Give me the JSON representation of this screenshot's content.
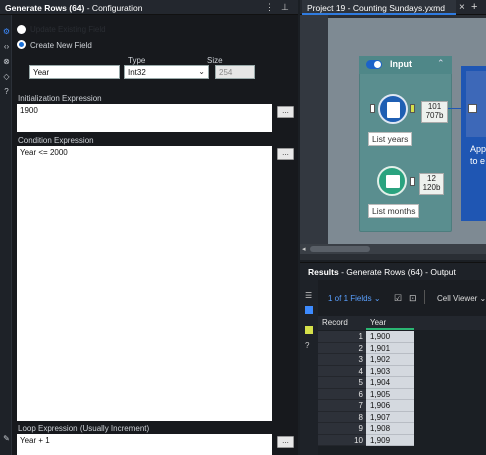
{
  "config": {
    "title_prefix": "Generate Rows (64)",
    "title_suffix": " - Configuration",
    "update_existing_label": "Update Existing Field",
    "create_new_label": "Create New  Field",
    "name_value": "Year",
    "type_label": "Type",
    "type_value": "Int32",
    "size_label": "Size",
    "size_value": "254",
    "init_label": "Initialization Expression",
    "init_value": "1900",
    "cond_label": "Condition Expression",
    "cond_value": "Year <= 2000",
    "loop_label": "Loop Expression (Usually Increment)",
    "loop_value": "Year + 1",
    "dots": "..."
  },
  "tab": {
    "title": "Project 19 - Counting Sundays.yxmd"
  },
  "canvas": {
    "container_title": "Input",
    "tool1_label": "List years",
    "tool1_count": "101",
    "tool1_size": "707b",
    "tool2_label": "List months",
    "tool2_count": "12",
    "tool2_size": "120b",
    "right_tool_text_1": "App",
    "right_tool_text_2": "to e"
  },
  "results": {
    "title_bold": "Results",
    "title_rest": " - Generate Rows (64) - Output",
    "fields_label": "1 of 1 Fields",
    "viewer_label": "Cell Viewer",
    "col_record": "Record",
    "col_year": "Year",
    "rows": [
      {
        "record": "1",
        "year": "1,900"
      },
      {
        "record": "2",
        "year": "1,901"
      },
      {
        "record": "3",
        "year": "1,902"
      },
      {
        "record": "4",
        "year": "1,903"
      },
      {
        "record": "5",
        "year": "1,904"
      },
      {
        "record": "6",
        "year": "1,905"
      },
      {
        "record": "7",
        "year": "1,906"
      },
      {
        "record": "8",
        "year": "1,907"
      },
      {
        "record": "9",
        "year": "1,908"
      },
      {
        "record": "10",
        "year": "1,909"
      }
    ]
  },
  "colors": {
    "accent": "#2f7be0",
    "container": "#5a8e8f",
    "year_underline": "#2bb673"
  }
}
